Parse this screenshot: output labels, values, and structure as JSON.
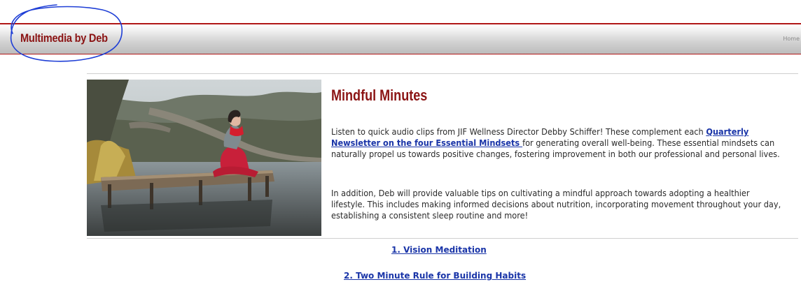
{
  "header": {
    "brand": "Multimedia by Deb",
    "nav_home": "Home",
    "accent_color": "#8b1414",
    "annotation_color": "#1f3fd6"
  },
  "main": {
    "image_icon": "woman-meditating-on-dock-photo",
    "title": "Mindful Minutes",
    "para1_before": "Listen to quick audio clips from JIF Wellness Director Debby Schiffer! These complement each ",
    "para1_link": "Quarterly Newsletter on the four Essential Mindsets ",
    "para1_after": "for generating overall well-being. These essential mindsets can naturally propel us towards positive changes, fostering improvement in both our professional and personal lives.",
    "para2": "In addition, Deb will provide valuable tips on cultivating a mindful approach towards adopting a healthier lifestyle. This includes making informed decisions about nutrition, incorporating movement throughout your day, establishing a consistent sleep routine and more!",
    "link_color": "#1a35a8"
  },
  "links": [
    {
      "label": "1. Vision Meditation"
    },
    {
      "label": "2. Two Minute Rule for Building Habits"
    }
  ]
}
